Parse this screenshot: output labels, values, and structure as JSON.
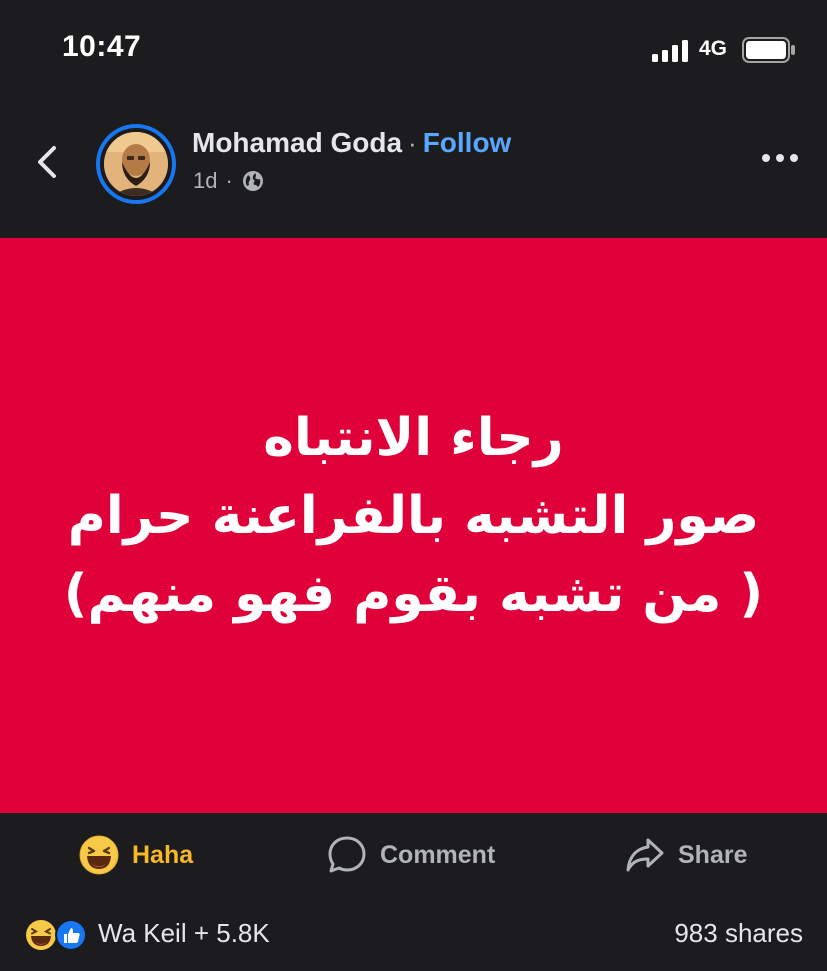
{
  "status_bar": {
    "time": "10:47",
    "network": "4G",
    "icons": [
      "signal-icon",
      "battery-icon"
    ]
  },
  "post": {
    "author": "Mohamad Goda",
    "separator": "·",
    "follow_label": "Follow",
    "age": "1d",
    "meta_separator": "·",
    "privacy_icon": "globe-icon",
    "image_text": {
      "line1": "رجاء الانتباه",
      "line2": "صور التشبه بالفراعنة حرام",
      "line3": "( من تشبه بقوم فهو منهم)"
    },
    "image_background": "#e0003a"
  },
  "actions": {
    "haha_label": "Haha",
    "comment_label": "Comment",
    "share_label": "Share",
    "haha_color": "#f7b928"
  },
  "reactions": {
    "summary": "Wa Keil + 5.8K",
    "shares": "983 shares",
    "icons": [
      "haha-reaction-icon",
      "like-reaction-icon"
    ]
  },
  "colors": {
    "background": "#1c1c1e",
    "accent_blue": "#1877f2",
    "follow_blue": "#5aa7ff"
  }
}
